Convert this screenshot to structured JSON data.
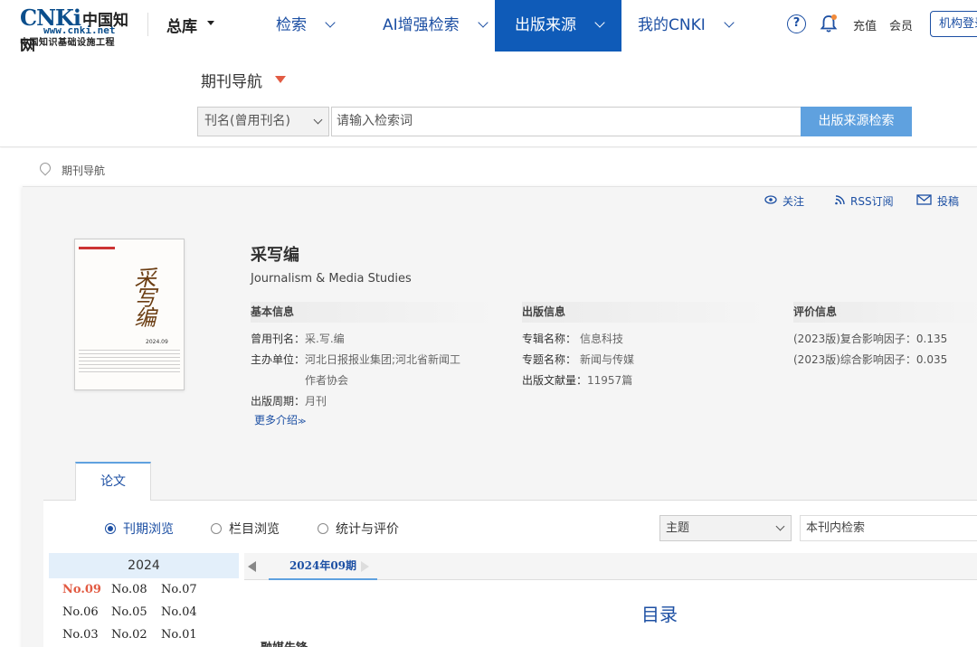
{
  "header": {
    "logo_brand": "CNKi",
    "logo_cn": "中国知网",
    "logo_url": "www.cnki.net",
    "logo_sub": "中国知识基础设施工程",
    "library": "总库",
    "nav": [
      "检索",
      "AI增强检索",
      "出版来源",
      "我的CNKI"
    ],
    "recharge": "充值",
    "member": "会员",
    "login": "机构登录"
  },
  "search": {
    "nav_title": "期刊导航",
    "field": "刊名(曾用刊名)",
    "placeholder": "请输入检索词",
    "button": "出版来源检索"
  },
  "breadcrumb": "期刊导航",
  "tools": {
    "follow": "关注",
    "rss": "RSS订阅",
    "submit": "投稿"
  },
  "journal": {
    "title": "采写编",
    "title_en": "Journalism & Media Studies",
    "cover_year": "2024.09",
    "basic": {
      "heading": "基本信息",
      "former_name_label": "曾用刊名：",
      "former_name": "采.写.编",
      "sponsor_label": "主办单位：",
      "sponsor_line1": "河北日报报业集团;河北省新闻工",
      "sponsor_line2": "作者协会",
      "cycle_label": "出版周期：",
      "cycle": "月刊",
      "more": "更多介绍"
    },
    "publish": {
      "heading": "出版信息",
      "series_label": "专辑名称：",
      "series": "信息科技",
      "topic_label": "专题名称：",
      "topic": "新闻与传媒",
      "count_label": "出版文献量：",
      "count": "11957篇"
    },
    "eval": {
      "heading": "评价信息",
      "composite": "(2023版)复合影响因子：0.135",
      "comprehensive": "(2023版)综合影响因子：0.035"
    }
  },
  "tab": "论文",
  "browse": {
    "options": [
      "刊期浏览",
      "栏目浏览",
      "统计与评价"
    ],
    "selected": "刊期浏览",
    "topic_select": "主题",
    "inner_search_placeholder": "本刊内检索"
  },
  "issues": {
    "year": "2024",
    "list": [
      "No.09",
      "No.08",
      "No.07",
      "No.06",
      "No.05",
      "No.04",
      "No.03",
      "No.02",
      "No.01"
    ],
    "current": "No.09",
    "current_label": "2024年09期"
  },
  "toc": {
    "title": "目录",
    "first_section": "融媒先锋"
  },
  "colors": {
    "primary": "#1c4fa3",
    "active_nav": "#0f5bb8",
    "search_button": "#5fa1df",
    "accent": "#e25b43"
  }
}
